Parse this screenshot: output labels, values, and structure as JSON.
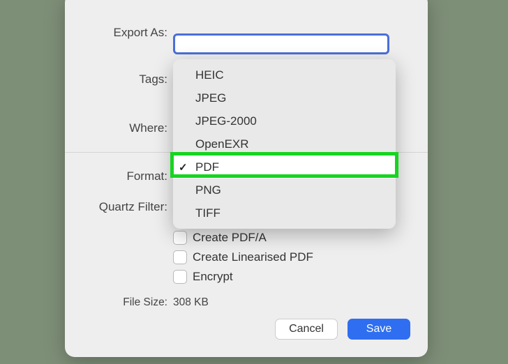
{
  "labels": {
    "export_as": "Export As:",
    "tags": "Tags:",
    "where": "Where:",
    "format": "Format:",
    "quartz_filter": "Quartz Filter:",
    "file_size_label": "File Size:"
  },
  "values": {
    "export_name": "",
    "file_size": "308 KB"
  },
  "checkboxes": {
    "create_pdfa": "Create PDF/A",
    "create_linearised": "Create Linearised PDF",
    "encrypt": "Encrypt"
  },
  "dropdown": {
    "items": [
      {
        "label": "HEIC"
      },
      {
        "label": "JPEG"
      },
      {
        "label": "JPEG-2000"
      },
      {
        "label": "OpenEXR"
      },
      {
        "label": "PDF"
      },
      {
        "label": "PNG"
      },
      {
        "label": "TIFF"
      }
    ],
    "selected_index": 4,
    "checkmark": "✓"
  },
  "buttons": {
    "cancel": "Cancel",
    "save": "Save"
  }
}
